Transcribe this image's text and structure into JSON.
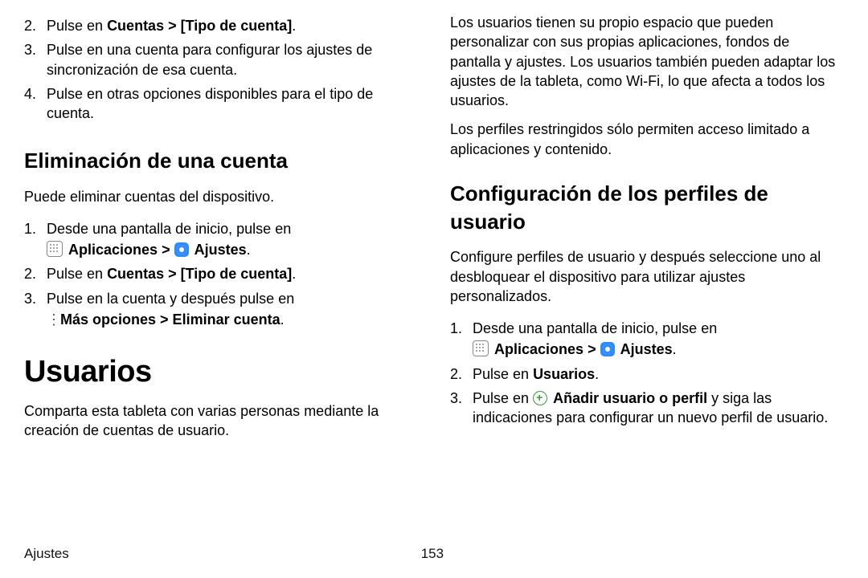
{
  "left": {
    "steps_top": [
      {
        "n": "2.",
        "pre": "Pulse en ",
        "bold": "Cuentas > [Tipo de cuenta]",
        "post": "."
      },
      {
        "n": "3.",
        "text": "Pulse en una cuenta para configurar los ajustes de sincronización de esa cuenta."
      },
      {
        "n": "4.",
        "text": "Pulse en otras opciones disponibles para el tipo de cuenta."
      }
    ],
    "h_delete": "Eliminación de una cuenta",
    "p_delete": "Puede eliminar cuentas del dispositivo.",
    "steps_delete": {
      "s1": {
        "n": "1.",
        "pre": "Desde una pantalla de inicio, pulse en "
      },
      "s1_icons": {
        "apps": "Aplicaciones",
        "sep": " > ",
        "settings": "Ajustes",
        "end": "."
      },
      "s2": {
        "n": "2.",
        "pre": "Pulse en ",
        "bold": "Cuentas > [Tipo de cuenta]",
        "post": "."
      },
      "s3": {
        "n": "3.",
        "text": "Pulse en la cuenta y después pulse en",
        "more": "Más opciones > Eliminar cuenta",
        "end": "."
      }
    },
    "h_users": "Usuarios",
    "p_users": "Comparta esta tableta con varias personas mediante la creación de cuentas de usuario."
  },
  "right": {
    "p1": "Los usuarios tienen su propio espacio que pueden personalizar con sus propias aplicaciones, fondos de pantalla y ajustes. Los usuarios también pueden adaptar los ajustes de la tableta, como Wi-Fi, lo que afecta a todos los usuarios.",
    "p2": "Los perfiles restringidos sólo permiten acceso limitado a aplicaciones y contenido.",
    "h_profiles": "Configuración de los perfiles de usuario",
    "p_profiles": "Configure perfiles de usuario y después seleccione uno al desbloquear el dispositivo para utilizar ajustes personalizados.",
    "steps": {
      "s1": {
        "n": "1.",
        "pre": "Desde una pantalla de inicio, pulse en "
      },
      "s1_icons": {
        "apps": "Aplicaciones",
        "sep": " > ",
        "settings": "Ajustes",
        "end": "."
      },
      "s2": {
        "n": "2.",
        "pre": "Pulse en ",
        "bold": "Usuarios",
        "post": "."
      },
      "s3": {
        "n": "3.",
        "pre": "Pulse en ",
        "bold": "Añadir usuario o perfil",
        "post": " y siga las indicaciones para configurar un nuevo perfil de usuario."
      }
    }
  },
  "footer": {
    "section": "Ajustes",
    "page": "153"
  }
}
